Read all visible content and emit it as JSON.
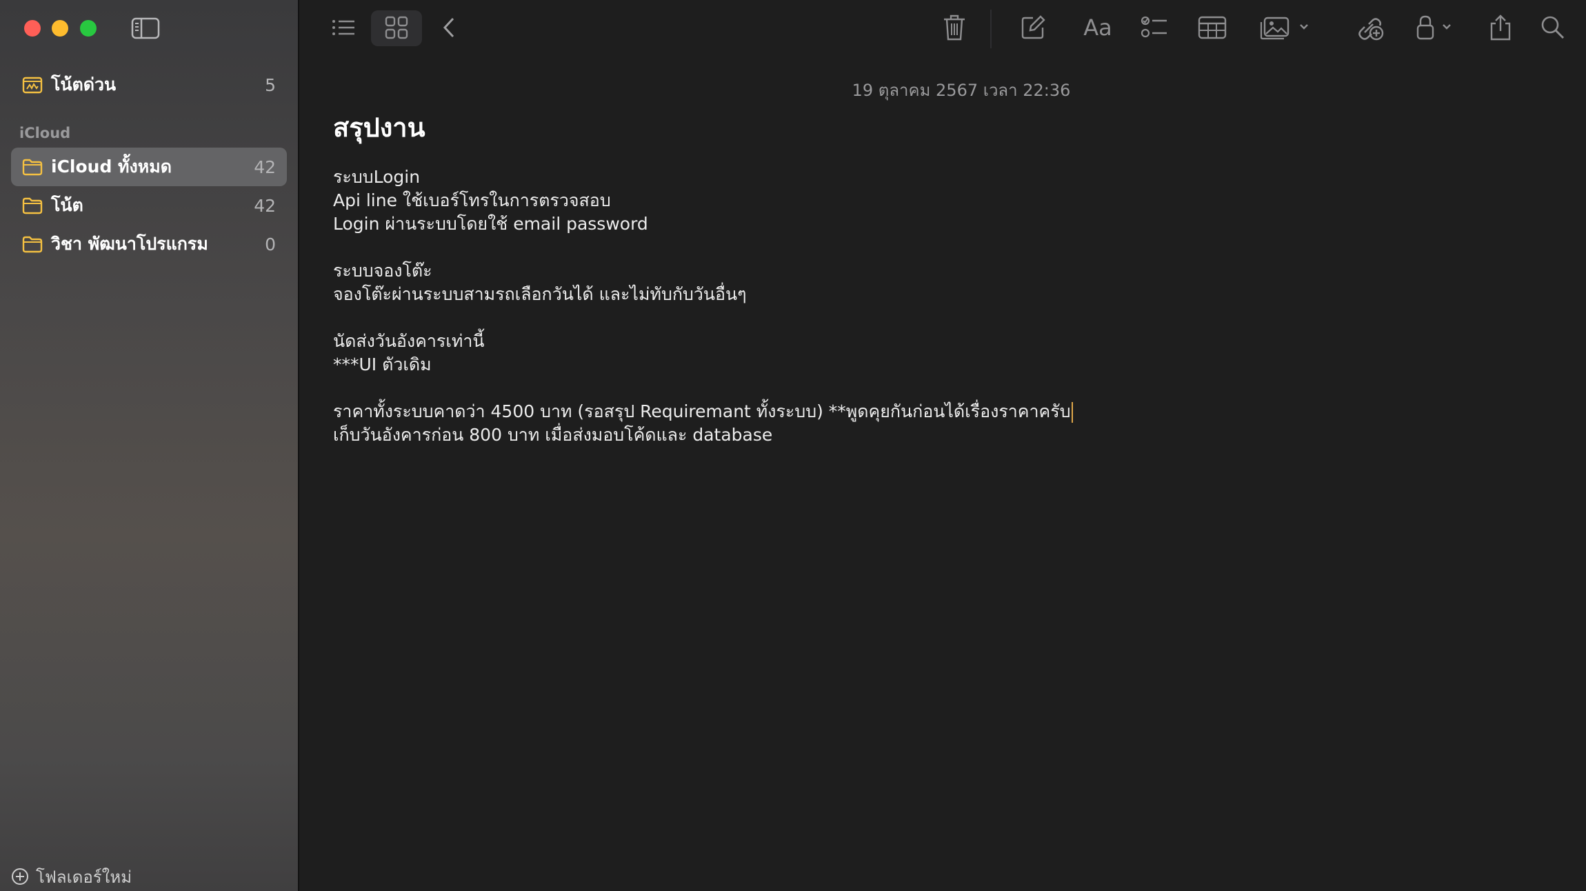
{
  "window": {
    "controls": [
      "close-button",
      "minimize-button",
      "zoom-button"
    ]
  },
  "sidebar": {
    "quick_notes": {
      "label": "โน้ตด่วน",
      "count": "5"
    },
    "section_title": "iCloud",
    "folders": [
      {
        "label": "iCloud ทั้งหมด",
        "count": "42",
        "selected": true
      },
      {
        "label": "โน้ต",
        "count": "42",
        "selected": false
      },
      {
        "label": "วิชา พัฒนาโปรแกรม",
        "count": "0",
        "selected": false
      }
    ],
    "new_folder_label": "โฟลเดอร์ใหม่"
  },
  "toolbar": {
    "icons": [
      "list-view-icon",
      "gallery-view-icon",
      "back-icon",
      "trash-icon",
      "compose-icon",
      "format-text-icon",
      "checklist-icon",
      "table-icon",
      "media-icon",
      "collaborate-icon",
      "lock-icon",
      "share-icon",
      "search-icon"
    ],
    "format_label": "Aa"
  },
  "note": {
    "date": "19 ตุลาคม 2567 เวลา 22:36",
    "title": "สรุปงาน",
    "lines": [
      "ระบบLogin",
      "Api line ใช้เบอร์โทรในการตรวจสอบ",
      "Login ผ่านระบบโดยใช้ email password",
      "",
      "ระบบจองโต๊ะ",
      "จองโต๊ะผ่านระบบสามรถเลือกวันได้ และไม่ทับกับวันอื่นๆ",
      "",
      "นัดส่งวันอังคารเท่านี้",
      "***UI ตัวเดิม",
      "",
      "ราคาทั้งระบบคาดว่า 4500 บาท (รอสรุป Requiremant ทั้งระบบ) **พูดคุยกันก่อนได้เรื่องราคาครับ",
      "เก็บวันอังคารก่อน 800 บาท เมื่อส่งมอบโค้ดและ database"
    ]
  },
  "colors": {
    "sidebar_bg": "#4a4848",
    "main_bg": "#1e1e1e",
    "folder_icon": "#f5c142",
    "selected_row": "#646466",
    "caret": "#e0a84a"
  }
}
